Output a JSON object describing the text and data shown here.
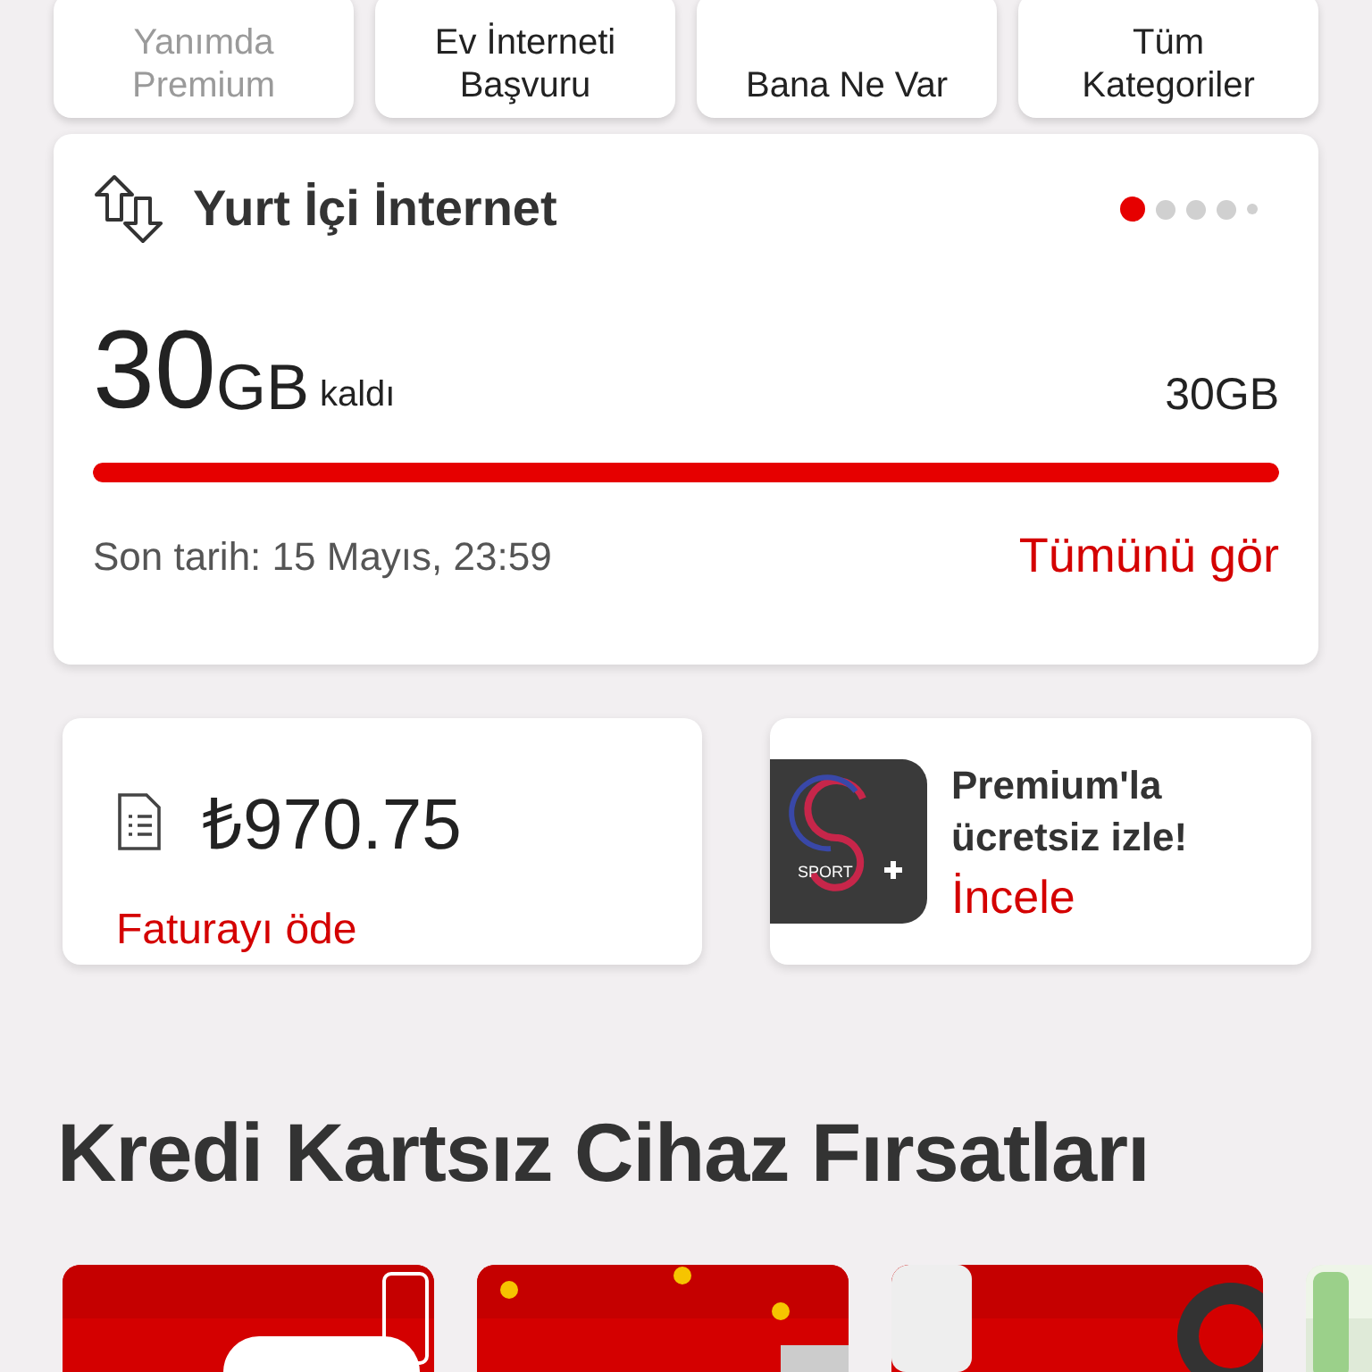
{
  "shortcuts": [
    {
      "label": "Yanımda Premium",
      "disabled": true
    },
    {
      "label": "Ev İnterneti Başvuru",
      "disabled": false
    },
    {
      "label": "Bana Ne Var",
      "disabled": false
    },
    {
      "label": "Tüm Kategoriler",
      "disabled": false
    }
  ],
  "usage_card": {
    "title": "Yurt İçi İnternet",
    "pager": [
      {
        "selected": true
      },
      {
        "selected": false
      },
      {
        "selected": false
      },
      {
        "selected": false
      },
      {
        "selected": false
      }
    ],
    "remaining": "30",
    "unit": "GB",
    "remaining_label": "kaldı",
    "total": "30GB",
    "level": 1,
    "deadline": "Son tarih: 15 Mayıs, 23:59",
    "link": "Tümünü gör"
  },
  "bill_card": {
    "amount": "₺970.75",
    "link": "Faturayı öde"
  },
  "promo_card": {
    "logo_text": "SPORT",
    "title": "Premium'la ücretsiz izle!",
    "link": "İncele"
  },
  "section_title": "Kredi Kartsız Cihaz Fırsatları"
}
